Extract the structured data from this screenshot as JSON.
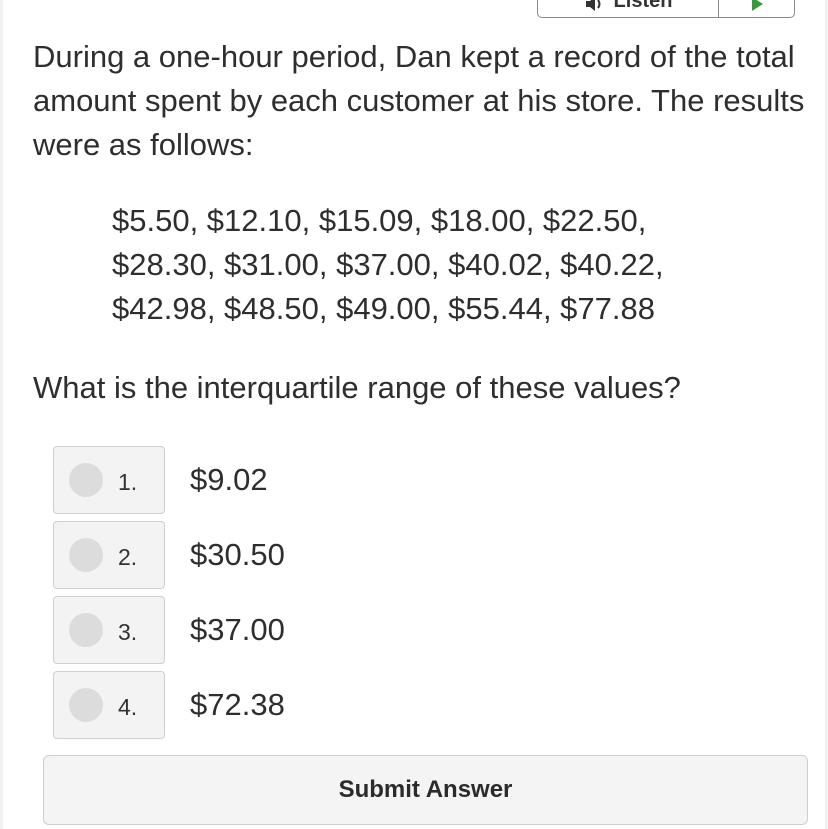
{
  "toolbar": {
    "listen_label": "Listen",
    "speaker_icon": "speaker-icon",
    "play_icon": "play-icon",
    "play_color": "#3a9a3a"
  },
  "question": {
    "text": "During a one-hour period, Dan kept a record of the total amount spent by each customer at his store. The results were as follows:",
    "data_lines": [
      "$5.50, $12.10, $15.09, $18.00, $22.50,",
      "$28.30, $31.00, $37.00, $40.02, $40.22,",
      "$42.98, $48.50, $49.00, $55.44, $77.88"
    ],
    "prompt": "What is the interquartile range of these values?"
  },
  "choices": [
    {
      "number": "1.",
      "text": "$9.02"
    },
    {
      "number": "2.",
      "text": "$30.50"
    },
    {
      "number": "3.",
      "text": "$37.00"
    },
    {
      "number": "4.",
      "text": "$72.38"
    }
  ],
  "submit": {
    "label": "Submit Answer"
  }
}
